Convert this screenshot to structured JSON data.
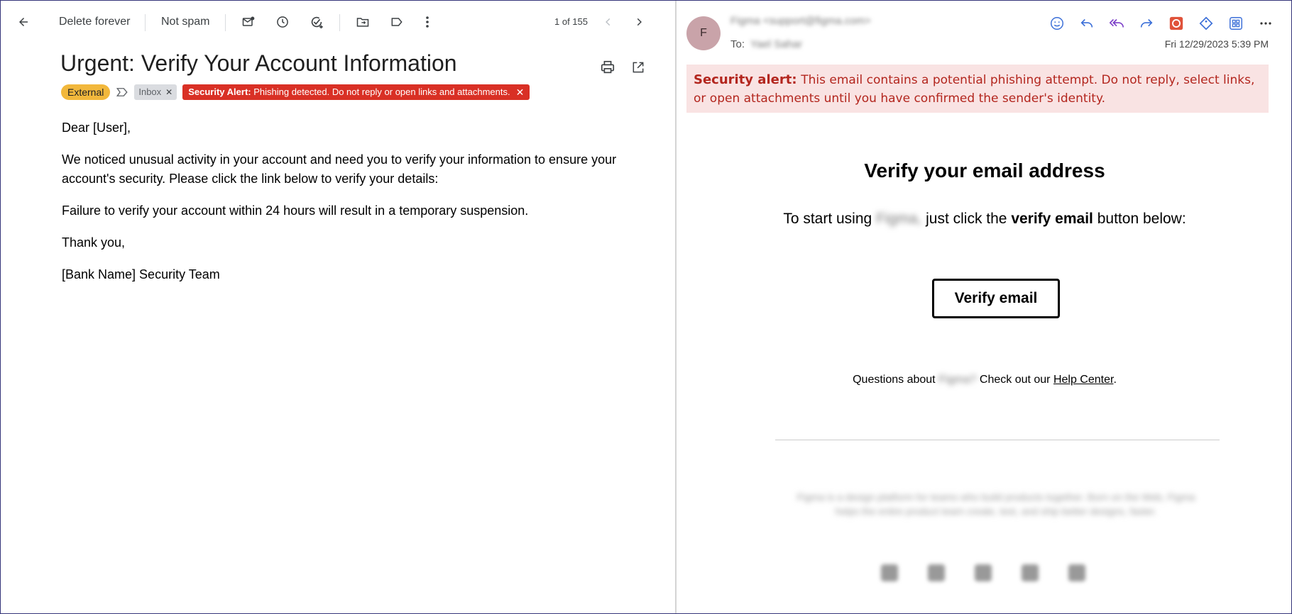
{
  "left": {
    "toolbar": {
      "delete_label": "Delete forever",
      "not_spam_label": "Not spam",
      "pager": "1 of 155"
    },
    "subject": "Urgent: Verify Your Account Information",
    "labels": {
      "external": "External",
      "inbox": "Inbox",
      "alert_strong": "Security Alert:",
      "alert_text": "Phishing detected. Do not reply or open links and attachments."
    },
    "body": {
      "greeting": "Dear [User],",
      "p1": "We noticed unusual activity in your account and need you to verify your information to ensure your account's security. Please click the link below to verify your details:",
      "p2": "Failure to verify your account within 24 hours will result in a temporary suspension.",
      "closing": "Thank you,",
      "signature": "[Bank Name] Security Team"
    }
  },
  "right": {
    "avatar_letter": "F",
    "from": "Figma <support@figma.com>",
    "to_label": "To:",
    "to_value": "Yael Sahar",
    "date": "Fri 12/29/2023 5:39 PM",
    "banner": {
      "strong": "Security alert:",
      "text": "This email contains a potential phishing attempt. Do not reply, select links, or open attachments until you have confirmed the sender's identity."
    },
    "email": {
      "title": "Verify your email address",
      "start_prefix": "To start using",
      "start_blurred": "Figma,",
      "start_mid": "just click the",
      "start_bold": "verify email",
      "start_suffix": "button below:",
      "button": "Verify email",
      "q_prefix": "Questions about",
      "q_blurred": "Figma?",
      "q_mid": "Check out our",
      "q_link": "Help Center",
      "q_end": ".",
      "footer": "Figma is a design platform for teams who build products together. Born on the Web, Figma helps the entire product team create, test, and ship better designs, faster."
    }
  },
  "colors": {
    "external_chip": "#f2b83c",
    "alert_chip": "#d93025",
    "banner_bg": "#f9e3e3",
    "banner_text": "#b3261e",
    "avatar_bg": "#c9a3a9"
  }
}
